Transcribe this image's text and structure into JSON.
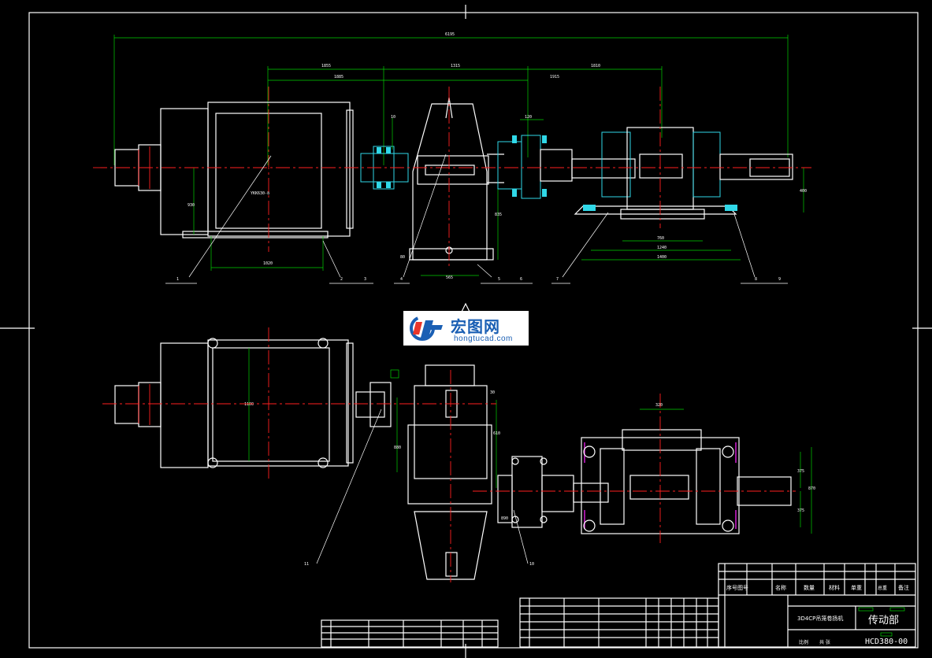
{
  "drawing": {
    "overall_dimension": "6195",
    "top_dimensions": [
      "1855",
      "1885",
      "1315",
      "1915",
      "1810"
    ],
    "motor_label": "YKK630-8",
    "dims_top_view": {
      "motor_height": "930",
      "motor_foot": "1020",
      "gearbox_foot": "565",
      "gearbox_height": "835",
      "shaft_h": "10",
      "coupling": "120",
      "bearing_span_1": "760",
      "bearing_span_2": "1240",
      "bearing_span_3": "1400",
      "shaft_height": "400",
      "ref_80": "80"
    },
    "dims_bottom_view": {
      "motor_width": "1100",
      "gearbox_width": "880",
      "gearbox_offset": "610",
      "gearbox_small": "30",
      "pitch": "320",
      "frame_w_1": "375",
      "frame_w_2": "375",
      "frame_total": "870",
      "ref_890": "890"
    },
    "balloons": [
      "1",
      "2",
      "3",
      "4",
      "5",
      "6",
      "7",
      "8",
      "9",
      "10",
      "11"
    ]
  },
  "watermark": {
    "name_cn": "宏图网",
    "url": "hongtucad.com"
  },
  "title_block": {
    "project": "3D4CP吊笼卷扬机",
    "drawing_title": "传动部",
    "drawing_number": "HCD380-00",
    "col_headers": [
      "序号",
      "图号",
      "名称",
      "数量",
      "材料",
      "单重",
      "总重",
      "备注"
    ],
    "scale_label": "比例",
    "sheet_label": "共 张"
  },
  "colors": {
    "background": "#000000",
    "outline": "#ffffff",
    "centerline": "#ff2020",
    "dimension": "#00d000",
    "coupling": "#30d8e8",
    "bolt_holes": "#e020e0",
    "logo_blue": "#1a5fb4"
  }
}
